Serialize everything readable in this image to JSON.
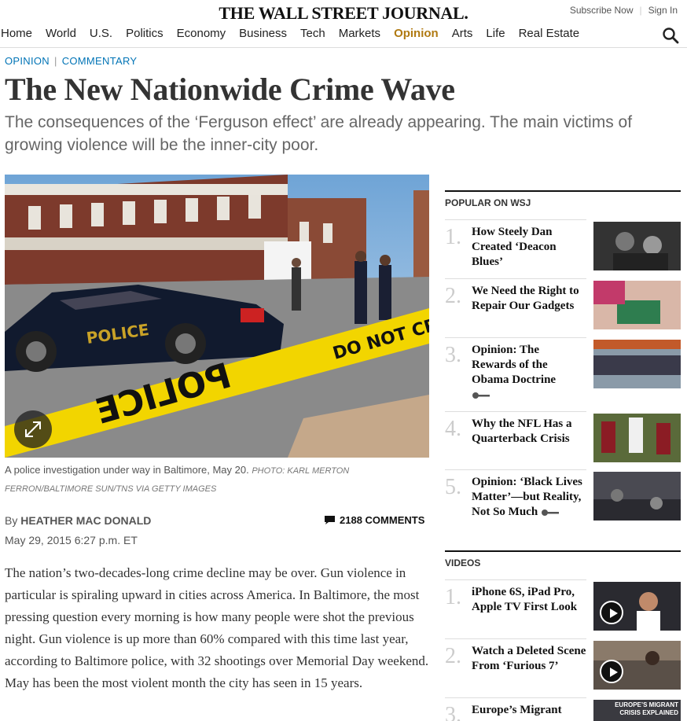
{
  "masthead": "THE WALL STREET JOURNAL.",
  "account": {
    "subscribe": "Subscribe Now",
    "signin": "Sign In"
  },
  "nav": [
    "Home",
    "World",
    "U.S.",
    "Politics",
    "Economy",
    "Business",
    "Tech",
    "Markets",
    "Opinion",
    "Arts",
    "Life",
    "Real Estate"
  ],
  "nav_active": "Opinion",
  "article": {
    "section": "OPINION",
    "subsection": "COMMENTARY",
    "headline": "The New Nationwide Crime Wave",
    "dek": "The consequences of the ‘Ferguson effect’ are already appearing. The main victims of growing violence will be the inner-city poor.",
    "caption": "A police investigation under way in Baltimore, May 20.",
    "credit": "PHOTO: KARL MERTON FERRON/BALTIMORE SUN/TNS VIA GETTY IMAGES",
    "byline_prefix": "By",
    "author": "HEATHER MAC DONALD",
    "comments": "2188 COMMENTS",
    "timestamp": "May 29, 2015 6:27 p.m. ET",
    "body": "The nation’s two-decades-long crime decline may be over. Gun violence in particular is spiraling upward in cities across America. In Baltimore, the most pressing question every morning is how many people were shot the previous night. Gun violence is up more than 60% compared with this time last year, according to Baltimore police, with 32 shootings over Memorial Day weekend. May has been the most violent month the city has seen in 15 years."
  },
  "popular": {
    "heading": "POPULAR ON WSJ",
    "items": [
      {
        "rank": "1.",
        "title": "How Steely Dan Created ‘Deacon Blues’",
        "locked": false
      },
      {
        "rank": "2.",
        "title": "We Need the Right to Repair Our Gadgets",
        "locked": false
      },
      {
        "rank": "3.",
        "title": "Opinion: The Rewards of the Obama Doctrine",
        "locked": true
      },
      {
        "rank": "4.",
        "title": "Why the NFL Has a Quarterback Crisis",
        "locked": false
      },
      {
        "rank": "5.",
        "title": "Opinion: ‘Black Lives Matter’—but Reality, Not So Much",
        "locked": true
      }
    ]
  },
  "videos": {
    "heading": "VIDEOS",
    "items": [
      {
        "rank": "1.",
        "title": "iPhone 6S, iPad Pro, Apple TV First Look"
      },
      {
        "rank": "2.",
        "title": "Watch a Deleted Scene From ‘Furious 7’"
      },
      {
        "rank": "3.",
        "title": "Europe’s Migrant",
        "thumb_label": "EUROPE’S MIGRANT CRISIS EXPLAINED"
      }
    ]
  },
  "colors": {
    "opinion_accent": "#b07a12",
    "link_blue": "#0274b6",
    "police_tape": "#f2d500"
  }
}
